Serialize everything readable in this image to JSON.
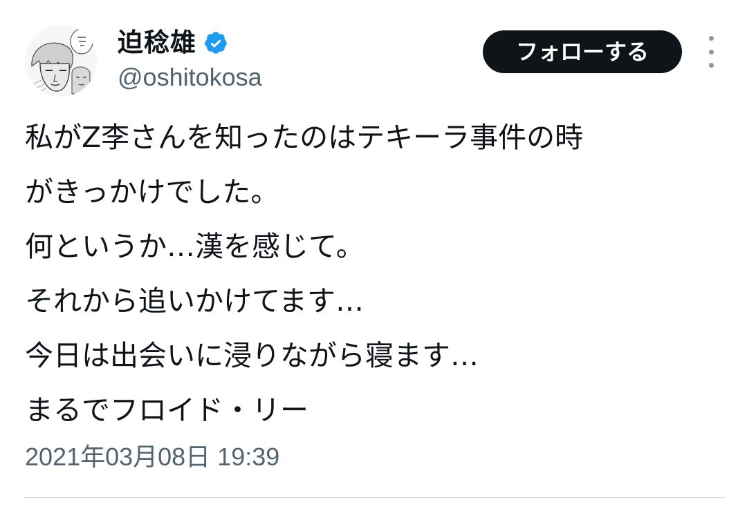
{
  "author": {
    "display_name": "迫稔雄",
    "handle": "@oshitokosa",
    "verified": true,
    "avatar_icon": "manga-portrait-avatar"
  },
  "actions": {
    "follow_label": "フォローする",
    "more_icon": "more-vertical-icon"
  },
  "tweet": {
    "lines": [
      "私がZ李さんを知ったのはテキーラ事件の時",
      "がきっかけでした。",
      "何というか…漢を感じて。",
      "それから追いかけてます…",
      "今日は出会いに浸りながら寝ます…",
      "まるでフロイド・リー"
    ],
    "timestamp": "2021年03月08日 19:39"
  },
  "colors": {
    "text": "#0f1419",
    "secondary": "#536471",
    "verified_badge": "#1d9bf0",
    "follow_bg": "#0f1419",
    "divider": "#cfd9de"
  }
}
